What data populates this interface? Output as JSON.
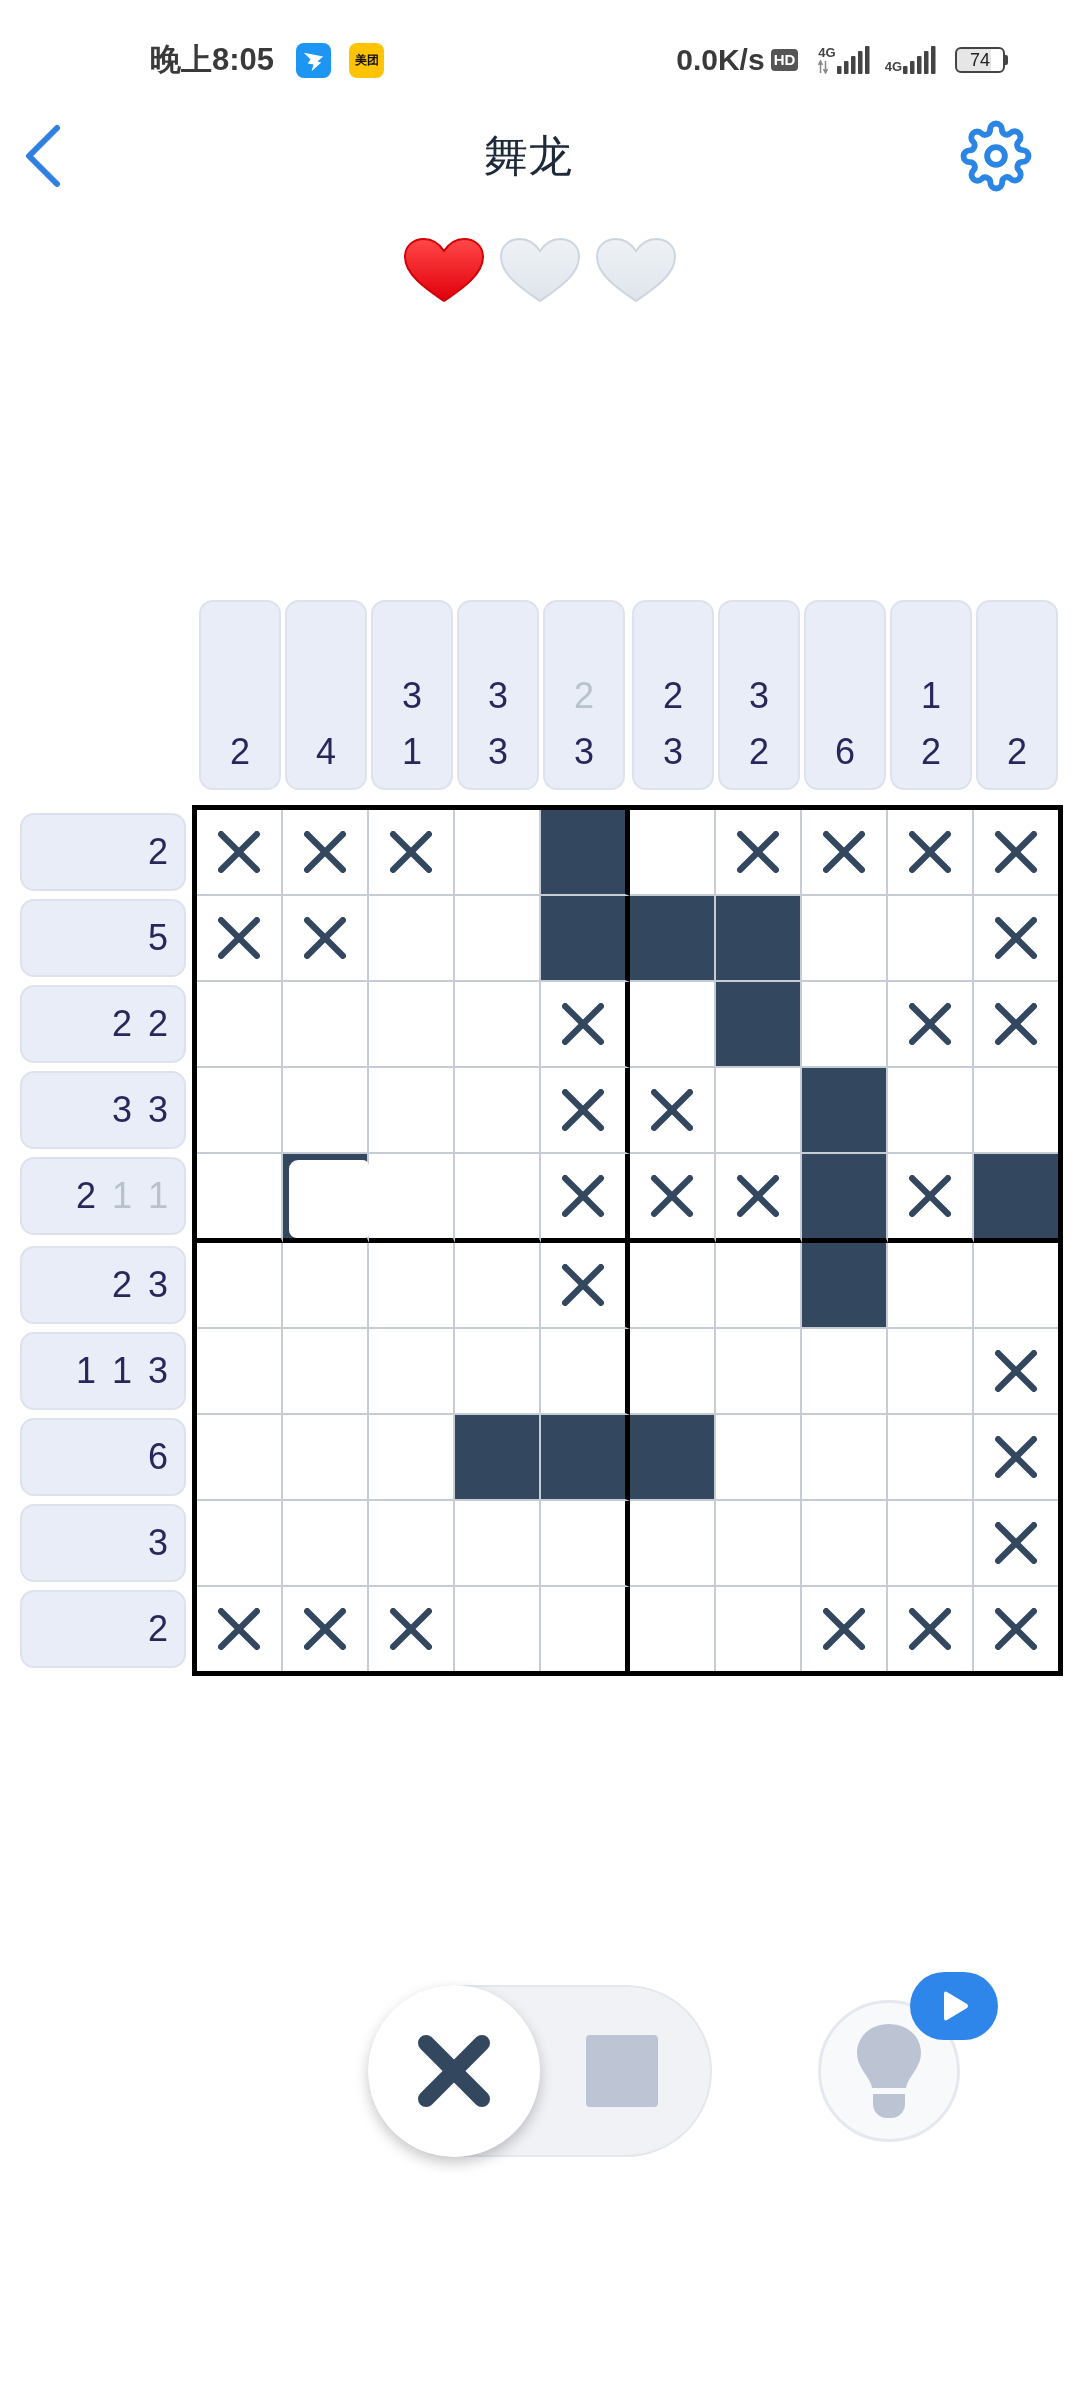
{
  "status_bar": {
    "time": "晚上8:05",
    "notification_icons": [
      {
        "kind": "wing"
      },
      {
        "kind": "label",
        "text": "美团"
      }
    ],
    "net_speed": "0.0K/s",
    "hd": "HD",
    "signals": [
      {
        "label": "4G",
        "activity": true
      },
      {
        "label": "4G",
        "activity": false
      }
    ],
    "battery": "74"
  },
  "header": {
    "title": "舞龙"
  },
  "lives": [
    {
      "filled": true
    },
    {
      "filled": false
    },
    {
      "filled": false
    }
  ],
  "puzzle": {
    "col_clues": [
      {
        "numbers": [
          {
            "text": "2",
            "done": false
          }
        ]
      },
      {
        "numbers": [
          {
            "text": "4",
            "done": false
          }
        ]
      },
      {
        "numbers": [
          {
            "text": "3",
            "done": false
          },
          {
            "text": "1",
            "done": false
          }
        ]
      },
      {
        "numbers": [
          {
            "text": "3",
            "done": false
          },
          {
            "text": "3",
            "done": false
          }
        ]
      },
      {
        "numbers": [
          {
            "text": "2",
            "done": true
          },
          {
            "text": "3",
            "done": false
          }
        ]
      },
      {
        "numbers": [
          {
            "text": "2",
            "done": false
          },
          {
            "text": "3",
            "done": false
          }
        ]
      },
      {
        "numbers": [
          {
            "text": "3",
            "done": false
          },
          {
            "text": "2",
            "done": false
          }
        ]
      },
      {
        "numbers": [
          {
            "text": "6",
            "done": false
          }
        ]
      },
      {
        "numbers": [
          {
            "text": "1",
            "done": false
          },
          {
            "text": "2",
            "done": false
          }
        ]
      },
      {
        "numbers": [
          {
            "text": "2",
            "done": false
          }
        ]
      }
    ],
    "row_clues": [
      {
        "numbers": [
          {
            "text": "2",
            "done": false
          }
        ]
      },
      {
        "numbers": [
          {
            "text": "5",
            "done": false
          }
        ]
      },
      {
        "numbers": [
          {
            "text": "2",
            "done": false
          },
          {
            "text": "2",
            "done": false
          }
        ]
      },
      {
        "numbers": [
          {
            "text": "3",
            "done": false
          },
          {
            "text": "3",
            "done": false
          }
        ]
      },
      {
        "numbers": [
          {
            "text": "2",
            "done": false
          },
          {
            "text": "1",
            "done": true
          },
          {
            "text": "1",
            "done": true
          }
        ]
      },
      {
        "numbers": [
          {
            "text": "2",
            "done": false
          },
          {
            "text": "3",
            "done": false
          }
        ]
      },
      {
        "numbers": [
          {
            "text": "1",
            "done": false
          },
          {
            "text": "1",
            "done": false
          },
          {
            "text": "3",
            "done": false
          }
        ]
      },
      {
        "numbers": [
          {
            "text": "6",
            "done": false
          }
        ]
      },
      {
        "numbers": [
          {
            "text": "3",
            "done": false
          }
        ]
      },
      {
        "numbers": [
          {
            "text": "2",
            "done": false
          }
        ]
      }
    ],
    "rows": [
      [
        {
          "kind": "crossed"
        },
        {
          "kind": "crossed"
        },
        {
          "kind": "crossed"
        },
        {
          "kind": "empty"
        },
        {
          "kind": "filled"
        },
        {
          "kind": "empty"
        },
        {
          "kind": "crossed"
        },
        {
          "kind": "crossed"
        },
        {
          "kind": "crossed"
        },
        {
          "kind": "crossed"
        }
      ],
      [
        {
          "kind": "crossed"
        },
        {
          "kind": "crossed"
        },
        {
          "kind": "empty"
        },
        {
          "kind": "empty"
        },
        {
          "kind": "filled"
        },
        {
          "kind": "filled"
        },
        {
          "kind": "filled"
        },
        {
          "kind": "empty"
        },
        {
          "kind": "empty"
        },
        {
          "kind": "crossed"
        }
      ],
      [
        {
          "kind": "empty"
        },
        {
          "kind": "empty"
        },
        {
          "kind": "empty"
        },
        {
          "kind": "empty"
        },
        {
          "kind": "crossed"
        },
        {
          "kind": "empty"
        },
        {
          "kind": "filled"
        },
        {
          "kind": "empty"
        },
        {
          "kind": "crossed"
        },
        {
          "kind": "crossed"
        }
      ],
      [
        {
          "kind": "empty"
        },
        {
          "kind": "empty"
        },
        {
          "kind": "empty"
        },
        {
          "kind": "empty"
        },
        {
          "kind": "crossed"
        },
        {
          "kind": "crossed"
        },
        {
          "kind": "empty"
        },
        {
          "kind": "filled"
        },
        {
          "kind": "empty"
        },
        {
          "kind": "empty"
        }
      ],
      [
        {
          "kind": "empty"
        },
        {
          "kind": "smudged"
        },
        {
          "kind": "empty"
        },
        {
          "kind": "empty"
        },
        {
          "kind": "crossed"
        },
        {
          "kind": "crossed"
        },
        {
          "kind": "crossed"
        },
        {
          "kind": "filled"
        },
        {
          "kind": "crossed"
        },
        {
          "kind": "filled"
        }
      ],
      [
        {
          "kind": "empty"
        },
        {
          "kind": "empty"
        },
        {
          "kind": "empty"
        },
        {
          "kind": "empty"
        },
        {
          "kind": "crossed"
        },
        {
          "kind": "empty"
        },
        {
          "kind": "empty"
        },
        {
          "kind": "filled"
        },
        {
          "kind": "empty"
        },
        {
          "kind": "empty"
        }
      ],
      [
        {
          "kind": "empty"
        },
        {
          "kind": "empty"
        },
        {
          "kind": "empty"
        },
        {
          "kind": "empty"
        },
        {
          "kind": "empty"
        },
        {
          "kind": "empty"
        },
        {
          "kind": "empty"
        },
        {
          "kind": "empty"
        },
        {
          "kind": "empty"
        },
        {
          "kind": "crossed"
        }
      ],
      [
        {
          "kind": "empty"
        },
        {
          "kind": "empty"
        },
        {
          "kind": "empty"
        },
        {
          "kind": "filled"
        },
        {
          "kind": "filled"
        },
        {
          "kind": "filled"
        },
        {
          "kind": "empty"
        },
        {
          "kind": "empty"
        },
        {
          "kind": "empty"
        },
        {
          "kind": "crossed"
        }
      ],
      [
        {
          "kind": "empty"
        },
        {
          "kind": "empty"
        },
        {
          "kind": "empty"
        },
        {
          "kind": "empty"
        },
        {
          "kind": "empty"
        },
        {
          "kind": "empty"
        },
        {
          "kind": "empty"
        },
        {
          "kind": "empty"
        },
        {
          "kind": "empty"
        },
        {
          "kind": "crossed"
        }
      ],
      [
        {
          "kind": "crossed"
        },
        {
          "kind": "crossed"
        },
        {
          "kind": "crossed"
        },
        {
          "kind": "empty"
        },
        {
          "kind": "empty"
        },
        {
          "kind": "empty"
        },
        {
          "kind": "empty"
        },
        {
          "kind": "crossed"
        },
        {
          "kind": "crossed"
        },
        {
          "kind": "crossed"
        }
      ]
    ]
  },
  "controls": {
    "modes": [
      {
        "kind": "cross",
        "selected": true
      },
      {
        "kind": "fill",
        "selected": false
      }
    ]
  }
}
